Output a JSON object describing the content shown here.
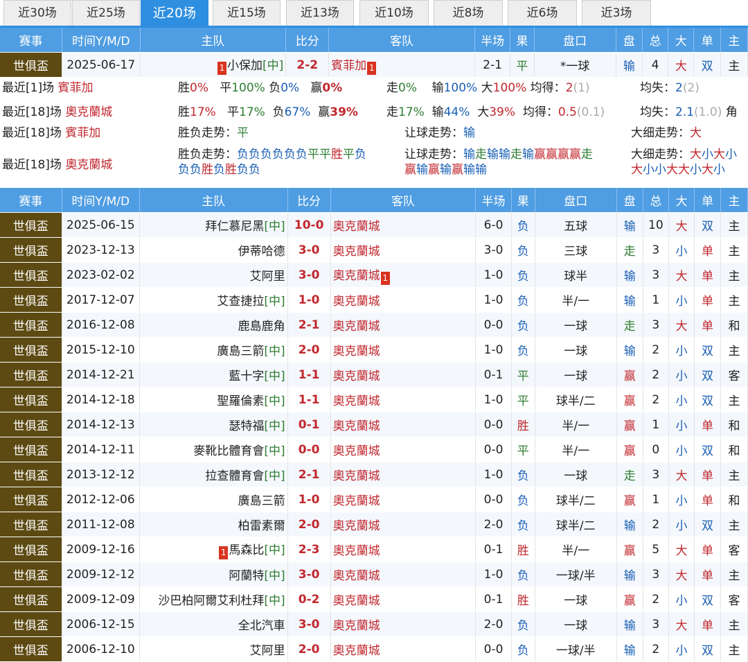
{
  "tabs": [
    "近30场",
    "近25场",
    "近20场",
    "近15场",
    "近13场",
    "近10场",
    "近8场",
    "近6场",
    "近3场"
  ],
  "active_tab": 2,
  "headers": [
    "赛事",
    "时间Y/M/D",
    "主队",
    "比分",
    "客队",
    "半场",
    "果",
    "盘口",
    "盘",
    "总",
    "大",
    "单",
    "主"
  ],
  "top_match": {
    "comp": "世俱盃",
    "date": "2025-06-17",
    "home": "小保加",
    "home_neutral": "[中]",
    "home_red_card": "1",
    "score": "2-2",
    "away": "賓菲加",
    "away_red_card": "1",
    "half": "2-1",
    "result": "平",
    "handicap": "*一球",
    "pan": "输",
    "total": "4",
    "bigsmall": "大",
    "oddeven": "双",
    "extra": "主"
  },
  "stats": {
    "row1": {
      "prefix": "最近[1]场",
      "team": "賓菲加",
      "win_label": "胜",
      "win": "0%",
      "draw_label": "平",
      "draw": "100%",
      "lose_label": "负",
      "lose": "0%",
      "ying_label": "赢",
      "ying": "0%",
      "zou_label": "走",
      "zou": "0%",
      "shu_label": "输",
      "shu": "100%",
      "big_label": "大",
      "big": "100%",
      "avg_gain_label": "均得：",
      "avg_gain": "2",
      "avg_gain_sub": "(1)",
      "avg_loss_label": "均失：",
      "avg_loss": "2",
      "avg_loss_sub": "(2)"
    },
    "row2": {
      "prefix": "最近[18]场",
      "team": "奧克蘭城",
      "win_label": "胜",
      "win": "17%",
      "draw_label": "平",
      "draw": "17%",
      "lose_label": "负",
      "lose": "67%",
      "ying_label": "赢",
      "ying": "39%",
      "zou_label": "走",
      "zou": "17%",
      "shu_label": "输",
      "shu": "44%",
      "big_label": "大",
      "big": "39%",
      "avg_gain_label": "均得：",
      "avg_gain": "0.5",
      "avg_gain_sub": "(0.1)",
      "avg_loss_label": "均失：",
      "avg_loss": "2.1",
      "avg_loss_sub": "(1.0)",
      "tail": "角"
    },
    "row3": {
      "prefix": "最近[18]场",
      "team": "賓菲加",
      "trend_label": "胜负走势：",
      "trend": "平",
      "handicap_label": "让球走势：",
      "handicap": "输",
      "bs_label": "大细走势：",
      "bs": "大"
    },
    "row4": {
      "prefix": "最近[18]场",
      "team": "奧克蘭城",
      "trend_label": "胜负走势：",
      "trend_line1": [
        "负",
        "负",
        "负",
        "负",
        "负",
        "负",
        "平",
        "平",
        "胜",
        "平",
        "负"
      ],
      "trend_line2": [
        "负",
        "负",
        "胜",
        "负",
        "胜",
        "负",
        "负"
      ],
      "handicap_label": "让球走势：",
      "handicap_line1": [
        "输",
        "走",
        "输",
        "输",
        "走",
        "输",
        "赢",
        "赢",
        "赢",
        "赢",
        "走"
      ],
      "handicap_line2": [
        "赢",
        "输",
        "赢",
        "输",
        "赢",
        "输",
        "输"
      ],
      "bs_label": "大细走势：",
      "bs_line1": [
        "大",
        "小",
        "大",
        "小"
      ],
      "bs_line2": [
        "大",
        "小",
        "小",
        "大",
        "大",
        "小",
        "大",
        "小"
      ]
    }
  },
  "matches": [
    {
      "comp": "世俱盃",
      "date": "2025-06-15",
      "home": "拜仁慕尼黑",
      "neutral": "[中]",
      "score": "10-0",
      "away": "奧克蘭城",
      "half": "6-0",
      "result": "负",
      "handicap": "五球",
      "pan": "输",
      "total": "10",
      "bs": "大",
      "oe": "双",
      "extra": "主"
    },
    {
      "comp": "世俱盃",
      "date": "2023-12-13",
      "home": "伊蒂哈德",
      "neutral": "",
      "score": "3-0",
      "away": "奧克蘭城",
      "half": "3-0",
      "result": "负",
      "handicap": "三球",
      "pan": "走",
      "total": "3",
      "bs": "小",
      "oe": "单",
      "extra": "主"
    },
    {
      "comp": "世俱盃",
      "date": "2023-02-02",
      "home": "艾阿里",
      "neutral": "",
      "score": "3-0",
      "away": "奧克蘭城",
      "away_red": "1",
      "half": "1-0",
      "result": "负",
      "handicap": "球半",
      "pan": "输",
      "total": "3",
      "bs": "大",
      "oe": "单",
      "extra": "主"
    },
    {
      "comp": "世俱盃",
      "date": "2017-12-07",
      "home": "艾查捷拉",
      "neutral": "[中]",
      "score": "1-0",
      "away": "奧克蘭城",
      "half": "1-0",
      "result": "负",
      "handicap": "半/一",
      "pan": "输",
      "total": "1",
      "bs": "小",
      "oe": "单",
      "extra": "主"
    },
    {
      "comp": "世俱盃",
      "date": "2016-12-08",
      "home": "鹿島鹿角",
      "neutral": "",
      "score": "2-1",
      "away": "奧克蘭城",
      "half": "0-0",
      "result": "负",
      "handicap": "一球",
      "pan": "走",
      "total": "3",
      "bs": "大",
      "oe": "单",
      "extra": "和"
    },
    {
      "comp": "世俱盃",
      "date": "2015-12-10",
      "home": "廣島三箭",
      "neutral": "[中]",
      "score": "2-0",
      "away": "奧克蘭城",
      "half": "1-0",
      "result": "负",
      "handicap": "一球",
      "pan": "输",
      "total": "2",
      "bs": "小",
      "oe": "双",
      "extra": "主"
    },
    {
      "comp": "世俱盃",
      "date": "2014-12-21",
      "home": "藍十字",
      "neutral": "[中]",
      "score": "1-1",
      "away": "奧克蘭城",
      "half": "0-1",
      "result": "平",
      "handicap": "一球",
      "pan": "赢",
      "total": "2",
      "bs": "小",
      "oe": "双",
      "extra": "客"
    },
    {
      "comp": "世俱盃",
      "date": "2014-12-18",
      "home": "聖羅倫素",
      "neutral": "[中]",
      "score": "1-1",
      "away": "奧克蘭城",
      "half": "1-0",
      "result": "平",
      "handicap": "球半/二",
      "pan": "赢",
      "total": "2",
      "bs": "小",
      "oe": "双",
      "extra": "主"
    },
    {
      "comp": "世俱盃",
      "date": "2014-12-13",
      "home": "瑟特福",
      "neutral": "[中]",
      "score": "0-1",
      "away": "奧克蘭城",
      "half": "0-0",
      "result": "胜",
      "handicap": "半/一",
      "pan": "赢",
      "total": "1",
      "bs": "小",
      "oe": "单",
      "extra": "和"
    },
    {
      "comp": "世俱盃",
      "date": "2014-12-11",
      "home": "麥靴比體育會",
      "neutral": "[中]",
      "score": "0-0",
      "away": "奧克蘭城",
      "half": "0-0",
      "result": "平",
      "handicap": "半/一",
      "pan": "赢",
      "total": "0",
      "bs": "小",
      "oe": "双",
      "extra": "和"
    },
    {
      "comp": "世俱盃",
      "date": "2013-12-12",
      "home": "拉查體育會",
      "neutral": "[中]",
      "score": "2-1",
      "away": "奧克蘭城",
      "half": "1-0",
      "result": "负",
      "handicap": "一球",
      "pan": "走",
      "total": "3",
      "bs": "大",
      "oe": "单",
      "extra": "主"
    },
    {
      "comp": "世俱盃",
      "date": "2012-12-06",
      "home": "廣島三箭",
      "neutral": "",
      "score": "1-0",
      "away": "奧克蘭城",
      "half": "0-0",
      "result": "负",
      "handicap": "球半/二",
      "pan": "赢",
      "total": "1",
      "bs": "小",
      "oe": "单",
      "extra": "和"
    },
    {
      "comp": "世俱盃",
      "date": "2011-12-08",
      "home": "柏雷素爾",
      "neutral": "",
      "score": "2-0",
      "away": "奧克蘭城",
      "half": "2-0",
      "result": "负",
      "handicap": "球半/二",
      "pan": "输",
      "total": "2",
      "bs": "小",
      "oe": "双",
      "extra": "主"
    },
    {
      "comp": "世俱盃",
      "date": "2009-12-16",
      "home": "馬森比",
      "home_red": "1",
      "neutral": "[中]",
      "score": "2-3",
      "away": "奧克蘭城",
      "half": "0-1",
      "result": "胜",
      "handicap": "半/一",
      "pan": "赢",
      "total": "5",
      "bs": "大",
      "oe": "单",
      "extra": "客"
    },
    {
      "comp": "世俱盃",
      "date": "2009-12-12",
      "home": "阿蘭特",
      "neutral": "[中]",
      "score": "3-0",
      "away": "奧克蘭城",
      "half": "1-0",
      "result": "负",
      "handicap": "一球/半",
      "pan": "输",
      "total": "3",
      "bs": "大",
      "oe": "单",
      "extra": "主"
    },
    {
      "comp": "世俱盃",
      "date": "2009-12-09",
      "home": "沙巴柏阿爾艾利杜拜",
      "neutral": "[中]",
      "score": "0-2",
      "away": "奧克蘭城",
      "half": "0-1",
      "result": "胜",
      "handicap": "一球",
      "pan": "赢",
      "total": "2",
      "bs": "小",
      "oe": "双",
      "extra": "客"
    },
    {
      "comp": "世俱盃",
      "date": "2006-12-15",
      "home": "全北汽車",
      "neutral": "",
      "score": "3-0",
      "away": "奧克蘭城",
      "half": "2-0",
      "result": "负",
      "handicap": "一球",
      "pan": "输",
      "total": "3",
      "bs": "大",
      "oe": "单",
      "extra": "主"
    },
    {
      "comp": "世俱盃",
      "date": "2006-12-10",
      "home": "艾阿里",
      "neutral": "",
      "score": "2-0",
      "away": "奧克蘭城",
      "half": "0-0",
      "result": "负",
      "handicap": "一球/半",
      "pan": "输",
      "total": "2",
      "bs": "小",
      "oe": "双",
      "extra": "主"
    }
  ]
}
